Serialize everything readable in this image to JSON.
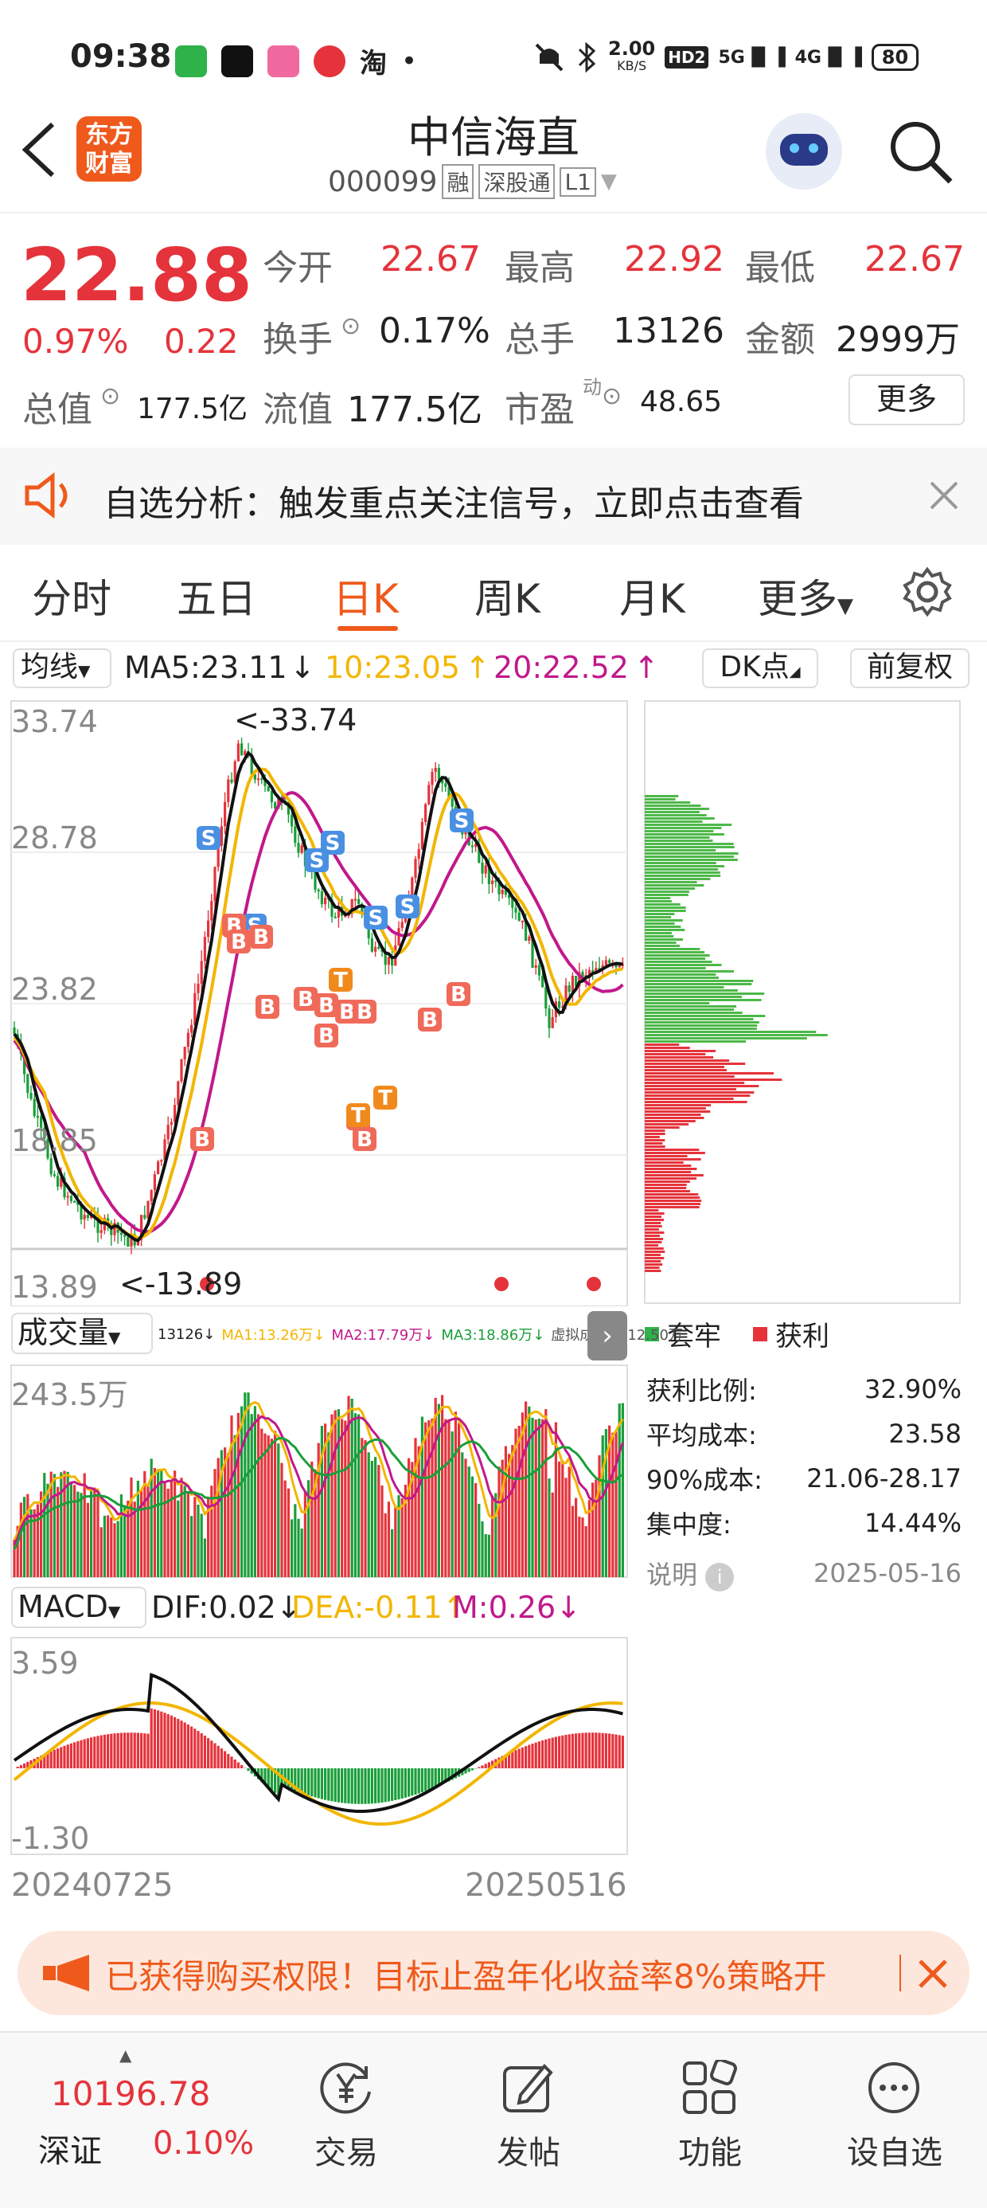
{
  "status_bar": {
    "time": "09:38",
    "app_icons": [
      "message-icon",
      "black-app-icon",
      "bilibili-icon",
      "netease-music-icon"
    ],
    "taobao": "淘",
    "dot": "•",
    "speed_value": "2.00",
    "speed_unit": "KB/S",
    "hd": "HD2",
    "net1": "5G",
    "net2": "4G",
    "battery": "80"
  },
  "header": {
    "logo_line1": "东方",
    "logo_line2": "财富",
    "title": "中信海直",
    "code": "000099",
    "tag1": "融",
    "tag2": "深股通",
    "tag3": "L1"
  },
  "quote": {
    "price": "22.88",
    "change_pct": "0.97%",
    "change": "0.22",
    "open_label": "今开",
    "open": "22.67",
    "high_label": "最高",
    "high": "22.92",
    "low_label": "最低",
    "low": "22.67",
    "turnover_label": "换手",
    "turnover": "0.17%",
    "volume_label": "总手",
    "volume": "13126",
    "amount_label": "金额",
    "amount": "2999万",
    "mktcap_label": "总值",
    "mktcap": "177.5亿",
    "float_label": "流值",
    "float": "177.5亿",
    "pe_label": "市盈",
    "pe_sup": "动",
    "pe": "48.65",
    "more": "更多"
  },
  "alert": {
    "text": "自选分析：触发重点关注信号，立即点击查看"
  },
  "tabs": [
    "分时",
    "五日",
    "日K",
    "周K",
    "月K",
    "更多"
  ],
  "active_tab": 2,
  "kline": {
    "ma_selector": "均线",
    "ma5": "MA5:23.11",
    "ma10": "10:23.05",
    "ma20": "20:22.52",
    "dk": "DK点",
    "adjust": "前复权",
    "y_labels": [
      "33.74",
      "28.78",
      "23.82",
      "18.85",
      "13.89"
    ],
    "max_marker": "<-33.74",
    "min_marker": "<-13.89",
    "colors": {
      "up": "#e5333b",
      "down": "#1a9e3a",
      "ma5": "#111111",
      "ma10": "#f2b600",
      "ma20": "#c2188b"
    }
  },
  "volume_panel": {
    "label": "成交量",
    "info": "13126↓",
    "ma1": "MA1:13.26万↓",
    "ma2": "MA2:17.79万↓",
    "ma3": "MA3:18.86万↓",
    "virtual": "虚拟成交量:12.50万",
    "max_label": "243.5万"
  },
  "macd_panel": {
    "label": "MACD",
    "dif": "DIF:0.02",
    "dea": "DEA:-0.11",
    "m": "M:0.26",
    "top_label": "3.59",
    "bottom_label": "-1.30",
    "start_date": "20240725",
    "end_date": "20250516"
  },
  "chip": {
    "legend_trapped": "套牢",
    "legend_profit": "获利",
    "rows": [
      {
        "label": "获利比例:",
        "value": "32.90%"
      },
      {
        "label": "平均成本:",
        "value": "23.58"
      },
      {
        "label": "90%成本:",
        "value": "21.06-28.17"
      },
      {
        "label": "集中度:",
        "value": "14.44%"
      }
    ],
    "note_label": "说明",
    "date": "2025-05-16"
  },
  "banner": {
    "text": "已获得购买权限！目标止盈年化收益率8%策略开"
  },
  "bottom_nav": {
    "index_value": "10196.78",
    "index_name": "深证",
    "index_change": "0.10%",
    "items": [
      "交易",
      "发帖",
      "功能",
      "设自选"
    ]
  }
}
